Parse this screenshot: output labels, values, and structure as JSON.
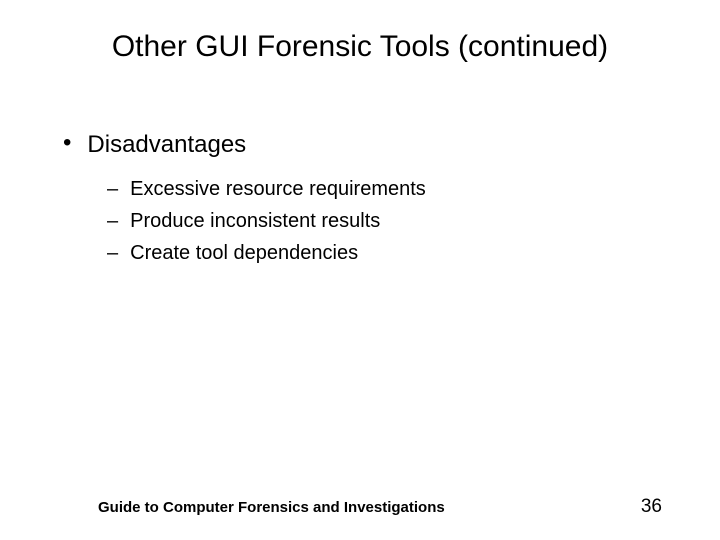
{
  "title": "Other GUI Forensic Tools (continued)",
  "bullets": {
    "level1": {
      "marker": "•",
      "text": "Disadvantages"
    },
    "level2": [
      {
        "marker": "–",
        "text": "Excessive resource requirements"
      },
      {
        "marker": "–",
        "text": "Produce inconsistent results"
      },
      {
        "marker": "–",
        "text": "Create tool dependencies"
      }
    ]
  },
  "footer": {
    "text": "Guide to Computer Forensics and Investigations",
    "page": "36"
  }
}
